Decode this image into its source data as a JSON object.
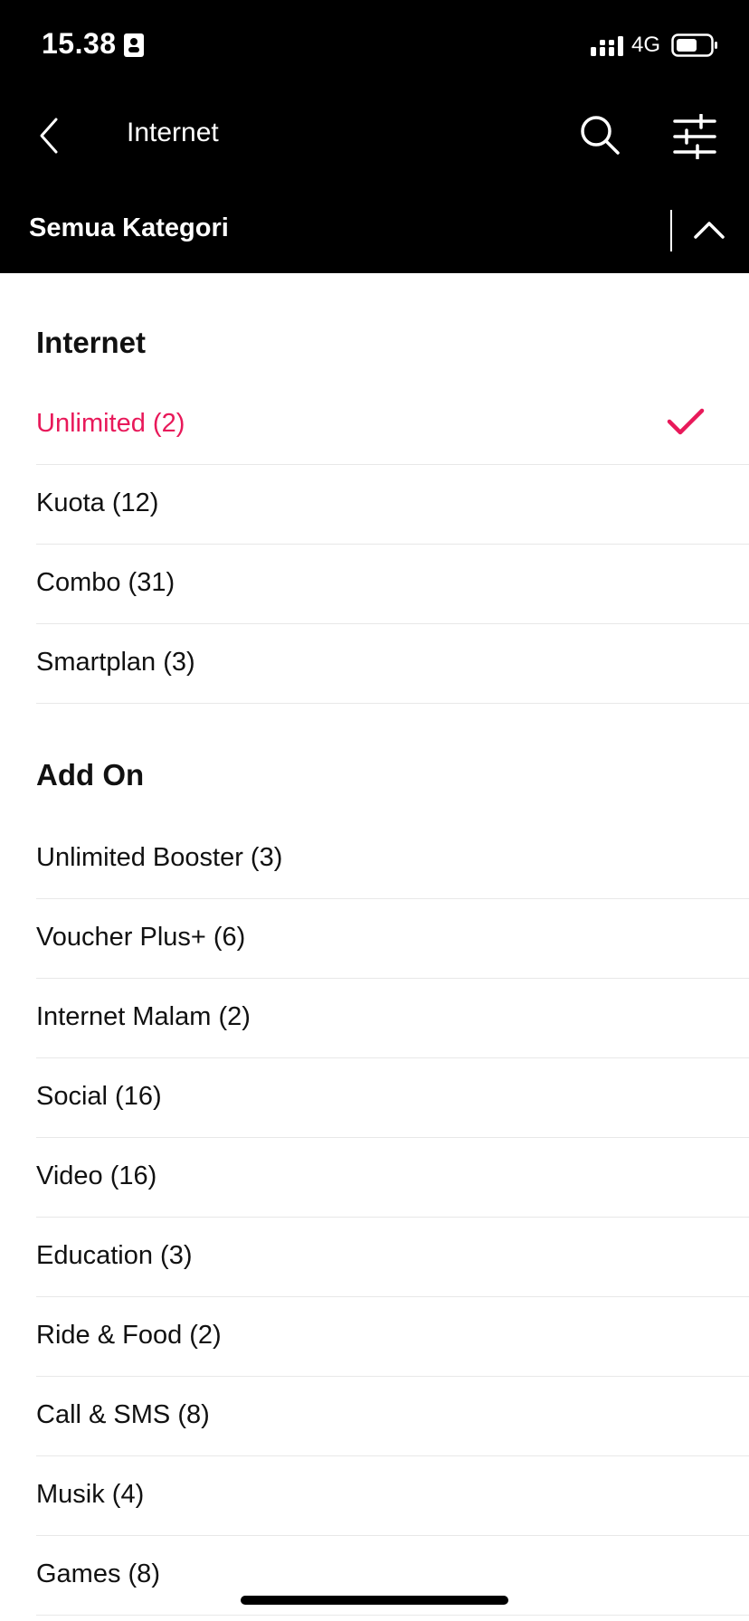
{
  "status_bar": {
    "time": "15.38",
    "network": "4G"
  },
  "nav": {
    "title": "Internet"
  },
  "category_bar": {
    "label": "Semua Kategori"
  },
  "sections": [
    {
      "title": "Internet",
      "items": [
        {
          "label": "Unlimited (2)",
          "selected": true
        },
        {
          "label": "Kuota (12)"
        },
        {
          "label": "Combo (31)"
        },
        {
          "label": "Smartplan (3)"
        }
      ]
    },
    {
      "title": "Add On",
      "items": [
        {
          "label": "Unlimited Booster (3)"
        },
        {
          "label": "Voucher Plus+ (6)"
        },
        {
          "label": "Internet Malam (2)"
        },
        {
          "label": "Social (16)"
        },
        {
          "label": "Video (16)"
        },
        {
          "label": "Education (3)"
        },
        {
          "label": "Ride & Food (2)"
        },
        {
          "label": "Call & SMS (8)"
        },
        {
          "label": "Musik (4)"
        },
        {
          "label": "Games (8)"
        }
      ]
    }
  ],
  "colors": {
    "accent": "#e8195a",
    "header_bg": "#000000"
  },
  "icons": [
    "contact-icon",
    "signal-icon",
    "battery-icon",
    "back-icon",
    "search-icon",
    "filter-icon",
    "chevron-up-icon",
    "check-icon"
  ]
}
